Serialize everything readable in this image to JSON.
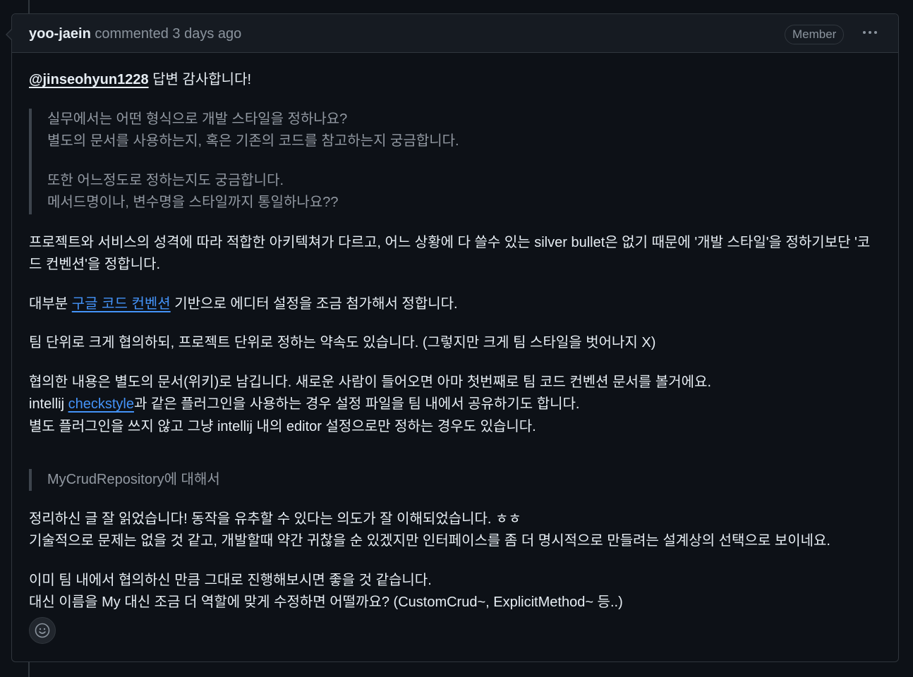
{
  "header": {
    "author": "yoo-jaein",
    "action": "commented",
    "time": "3 days ago",
    "badge": "Member",
    "menu_icon": "kebab-horizontal-icon"
  },
  "body": {
    "mention": "@jinseohyun1228",
    "mention_suffix": " 답변 감사합니다!",
    "quote1": {
      "line1": "실무에서는 어떤 형식으로 개발 스타일을 정하나요?",
      "line2": "별도의 문서를 사용하는지, 혹은 기존의 코드를 참고하는지 궁금합니다.",
      "line3": "또한 어느정도로 정하는지도 궁금합니다.",
      "line4": "메서드명이나, 변수명을 스타일까지 통일하나요??"
    },
    "para1_line1": "프로젝트와 서비스의 성격에 따라 적합한 아키텍쳐가 다르고, 어느 상황에 다 쓸수 있는 silver bullet은 없기 때문에 '개발 스타일'을 정하기보단 '코",
    "para1_line2": "드 컨벤션'을 정합니다.",
    "para2_prefix": "대부분 ",
    "para2_link": "구글 코드 컨벤션",
    "para2_suffix": " 기반으로 에디터 설정을 조금 첨가해서 정합니다.",
    "para3": "팀 단위로 크게 협의하되, 프로젝트 단위로 정하는 약속도 있습니다. (그렇지만 크게 팀 스타일을 벗어나지 X)",
    "para4_line1": "협의한 내용은 별도의 문서(위키)로 남깁니다. 새로운 사람이 들어오면 아마 첫번째로 팀 코드 컨벤션 문서를 볼거에요.",
    "para4_line2_prefix": "intellij ",
    "para4_line2_link": "checkstyle",
    "para4_line2_suffix": "과 같은 플러그인을 사용하는 경우 설정 파일을 팀 내에서 공유하기도 합니다.",
    "para4_line3": "별도 플러그인을 쓰지 않고 그냥 intellij 내의 editor 설정으로만 정하는 경우도 있습니다.",
    "quote2": "MyCrudRepository에 대해서",
    "para5_line1": "정리하신 글 잘 읽었습니다! 동작을 유추할 수 있다는 의도가 잘 이해되었습니다. ㅎㅎ",
    "para5_line2": "기술적으로 문제는 없을 것 같고, 개발할때 약간 귀찮을 순 있겠지만 인터페이스를 좀 더 명시적으로 만들려는 설계상의 선택으로 보이네요.",
    "para6_line1": "이미 팀 내에서 협의하신 만큼 그대로 진행해보시면 좋을 것 같습니다.",
    "para6_line2": "대신 이름을 My 대신 조금 더 역할에 맞게 수정하면 어떨까요? (CustomCrud~, ExplicitMethod~ 등..)"
  },
  "footer": {
    "reaction_icon": "smiley-icon"
  }
}
